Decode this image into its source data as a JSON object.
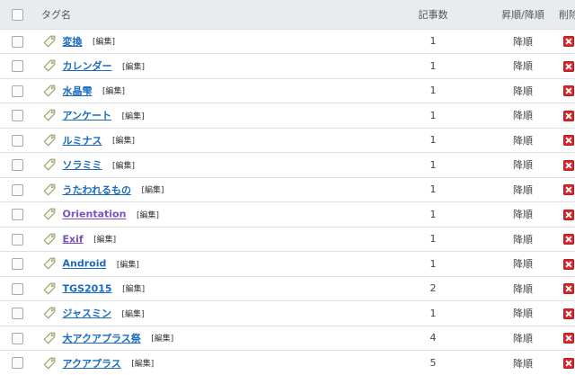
{
  "header": {
    "name_label": "タグ名",
    "count_label": "記事数",
    "order_label": "昇順/降順",
    "delete_label": "削除"
  },
  "colors": {
    "link": "#1a6bbf",
    "visited_link": "#7b4fc2",
    "delete": "#d9262a",
    "header_bg": "#e9ecef"
  },
  "rows": [
    {
      "name": "変換",
      "edit": "[編集]",
      "count": "1",
      "order": "降順",
      "visited": false
    },
    {
      "name": "カレンダー",
      "edit": "[編集]",
      "count": "1",
      "order": "降順",
      "visited": false
    },
    {
      "name": "水晶雫",
      "edit": "[編集]",
      "count": "1",
      "order": "降順",
      "visited": false
    },
    {
      "name": "アンケート",
      "edit": "[編集]",
      "count": "1",
      "order": "降順",
      "visited": false
    },
    {
      "name": "ルミナス",
      "edit": "[編集]",
      "count": "1",
      "order": "降順",
      "visited": false
    },
    {
      "name": "ソラミミ",
      "edit": "[編集]",
      "count": "1",
      "order": "降順",
      "visited": false
    },
    {
      "name": "うたわれるもの",
      "edit": "[編集]",
      "count": "1",
      "order": "降順",
      "visited": false
    },
    {
      "name": "Orientation",
      "edit": "[編集]",
      "count": "1",
      "order": "降順",
      "visited": true
    },
    {
      "name": "Exif",
      "edit": "[編集]",
      "count": "1",
      "order": "降順",
      "visited": true
    },
    {
      "name": "Android",
      "edit": "[編集]",
      "count": "1",
      "order": "降順",
      "visited": false
    },
    {
      "name": "TGS2015",
      "edit": "[編集]",
      "count": "2",
      "order": "降順",
      "visited": false
    },
    {
      "name": "ジャスミン",
      "edit": "[編集]",
      "count": "1",
      "order": "降順",
      "visited": false
    },
    {
      "name": "大アクアプラス祭",
      "edit": "[編集]",
      "count": "4",
      "order": "降順",
      "visited": false
    },
    {
      "name": "アクアプラス",
      "edit": "[編集]",
      "count": "5",
      "order": "降順",
      "visited": false
    }
  ]
}
